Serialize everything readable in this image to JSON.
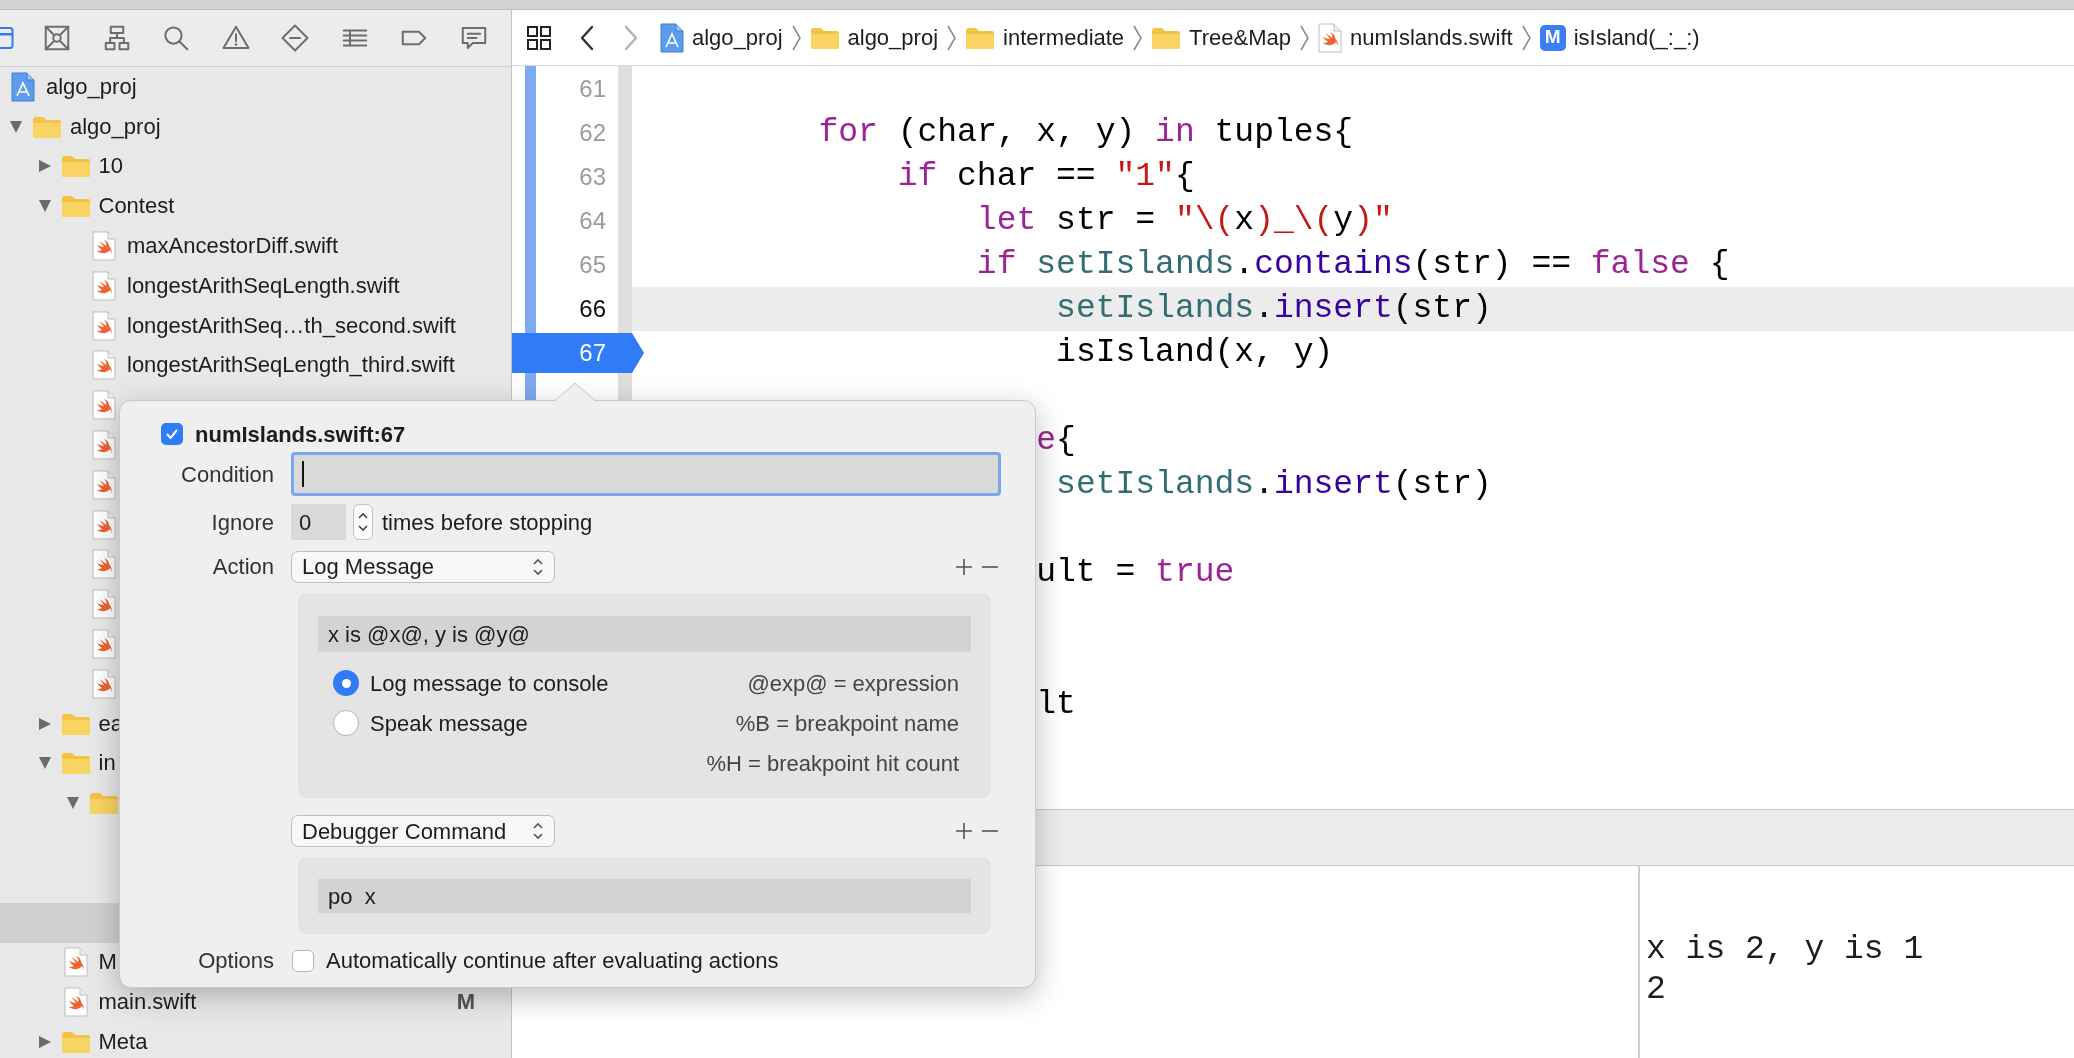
{
  "navigator_tabs": [
    {
      "kind": "project",
      "selected": true
    },
    {
      "kind": "source-control",
      "selected": false
    },
    {
      "kind": "symbols",
      "selected": false
    },
    {
      "kind": "find",
      "selected": false
    },
    {
      "kind": "issues",
      "selected": false
    },
    {
      "kind": "tests",
      "selected": false
    },
    {
      "kind": "debug",
      "selected": false
    },
    {
      "kind": "breakpoints",
      "selected": false
    },
    {
      "kind": "reports",
      "selected": false
    }
  ],
  "project_navigator": [
    {
      "kind": "project",
      "label": "algo_proj",
      "selected": false
    },
    {
      "kind": "folder",
      "label": "algo_proj",
      "expanded": true,
      "selected": false,
      "children": [
        {
          "kind": "folder",
          "label": "10",
          "expanded": false,
          "selected": false
        },
        {
          "kind": "folder",
          "label": "Contest",
          "expanded": true,
          "selected": false,
          "children": [
            {
              "kind": "swift",
              "label": "maxAncestorDiff.swift",
              "selected": false
            },
            {
              "kind": "swift",
              "label": "longestArithSeqLength.swift",
              "selected": false
            },
            {
              "kind": "swift",
              "label": "longestArithSeq…th_second.swift",
              "selected": false
            },
            {
              "kind": "swift",
              "label": "longestArithSeqLength_third.swift",
              "selected": false
            },
            {
              "kind": "swift",
              "selected": false
            },
            {
              "kind": "swift",
              "selected": false
            },
            {
              "kind": "swift",
              "selected": false
            },
            {
              "kind": "swift",
              "selected": false
            },
            {
              "kind": "swift",
              "selected": false
            },
            {
              "kind": "swift",
              "selected": false
            },
            {
              "kind": "swift",
              "selected": false
            },
            {
              "kind": "swift",
              "selected": false
            }
          ]
        },
        {
          "kind": "folder",
          "label": "ea",
          "expanded": false,
          "selected": false
        },
        {
          "kind": "folder",
          "label": "in",
          "expanded": true,
          "selected": false,
          "children": [
            {
              "kind": "folder",
              "expanded": true,
              "selected": false,
              "children": [
                {
                  "selected": false
                },
                {
                  "selected": false
                },
                {
                  "selected": true
                }
              ]
            }
          ]
        },
        {
          "kind": "swift",
          "label": "M",
          "selected": false
        },
        {
          "kind": "swift",
          "label": "main.swift",
          "status": "M",
          "selected": false
        },
        {
          "kind": "folder",
          "label": "Meta",
          "expanded": false,
          "selected": false
        }
      ]
    }
  ],
  "editor": {
    "jump_bar": {
      "back_enabled": true,
      "forward_enabled": false,
      "path": [
        {
          "kind": "project",
          "label": "algo_proj"
        },
        {
          "kind": "folder",
          "label": "algo_proj"
        },
        {
          "kind": "folder",
          "label": "intermediate"
        },
        {
          "kind": "folder",
          "label": "Tree&Map"
        },
        {
          "kind": "swift",
          "label": "numIslands.swift"
        },
        {
          "kind": "method",
          "badge": "M",
          "label": "isIsland(_:_:)"
        }
      ]
    },
    "lines": [
      {
        "number": "61",
        "highlighted": false,
        "breakpoint": false
      },
      {
        "number": "62",
        "highlighted": false,
        "breakpoint": false,
        "tokens": [
          {
            "kind": "keyword",
            "text": "        for"
          },
          {
            "kind": "plain",
            "text": " (char, x, y) "
          },
          {
            "kind": "keyword",
            "text": "in"
          },
          {
            "kind": "plain",
            "text": " tuples{"
          }
        ]
      },
      {
        "number": "63",
        "highlighted": false,
        "breakpoint": false,
        "tokens": [
          {
            "kind": "keyword",
            "text": "            if"
          },
          {
            "kind": "plain",
            "text": " char == "
          },
          {
            "kind": "string",
            "text": "\"1\""
          },
          {
            "kind": "plain",
            "text": "{"
          }
        ]
      },
      {
        "number": "64",
        "highlighted": false,
        "breakpoint": false,
        "tokens": [
          {
            "kind": "keyword",
            "text": "                let"
          },
          {
            "kind": "plain",
            "text": " str = "
          },
          {
            "kind": "string",
            "text": "\"\\("
          },
          {
            "kind": "plain",
            "text": "x"
          },
          {
            "kind": "string",
            "text": ")_\\("
          },
          {
            "kind": "plain",
            "text": "y"
          },
          {
            "kind": "string",
            "text": ")\""
          }
        ]
      },
      {
        "number": "65",
        "highlighted": false,
        "breakpoint": false,
        "tokens": [
          {
            "kind": "keyword",
            "text": "                if"
          },
          {
            "kind": "property",
            "text": " setIslands"
          },
          {
            "kind": "plain",
            "text": "."
          },
          {
            "kind": "method",
            "text": "contains"
          },
          {
            "kind": "plain",
            "text": "(str) == "
          },
          {
            "kind": "keyword",
            "text": "false"
          },
          {
            "kind": "plain",
            "text": " {"
          }
        ]
      },
      {
        "number": "66",
        "highlighted": true,
        "breakpoint": false,
        "tokens": [
          {
            "kind": "property",
            "text": "                    setIslands"
          },
          {
            "kind": "plain",
            "text": "."
          },
          {
            "kind": "method",
            "text": "insert"
          },
          {
            "kind": "plain",
            "text": "(str)"
          }
        ]
      },
      {
        "number": "67",
        "highlighted": false,
        "breakpoint": true,
        "tokens": [
          {
            "kind": "plain",
            "text": "                    isIsland(x, y)"
          }
        ]
      },
      {
        "highlighted": false
      },
      {
        "highlighted": false,
        "tokens": [
          {
            "kind": "keyword",
            "text": "                   e"
          },
          {
            "kind": "plain",
            "text": "{"
          }
        ]
      },
      {
        "highlighted": false,
        "tokens": [
          {
            "kind": "property",
            "text": "                    setIslands"
          },
          {
            "kind": "plain",
            "text": "."
          },
          {
            "kind": "method",
            "text": "insert"
          },
          {
            "kind": "plain",
            "text": "(str)"
          }
        ]
      },
      {
        "highlighted": false
      },
      {
        "highlighted": false,
        "tokens": [
          {
            "kind": "plain",
            "text": "                   ult = "
          },
          {
            "kind": "keyword",
            "text": "true"
          }
        ]
      },
      {
        "highlighted": false
      },
      {
        "highlighted": false
      },
      {
        "highlighted": false,
        "tokens": [
          {
            "kind": "plain",
            "text": "                   lt"
          }
        ]
      }
    ]
  },
  "debug_area": {
    "console_output": [
      "x is 2, y is 1",
      "2"
    ]
  },
  "breakpoint_editor": {
    "enabled": true,
    "title": "numIslands.swift:67",
    "condition": {
      "label": "Condition",
      "focused": true
    },
    "ignore": {
      "label": "Ignore",
      "value": "0",
      "suffix": "times before stopping"
    },
    "action_label": "Action",
    "actions": [
      {
        "kind": "log",
        "type": "Log Message",
        "message": "x is @x@, y is @y@",
        "modes": [
          {
            "label": "Log message to console",
            "selected": true
          },
          {
            "label": "Speak message",
            "selected": false
          }
        ],
        "hints": [
          "@exp@ = expression",
          "%B = breakpoint name",
          "%H = breakpoint hit count"
        ]
      },
      {
        "kind": "command",
        "type": "Debugger Command",
        "command": "po  x"
      }
    ],
    "options": {
      "label": "Options",
      "checked": false,
      "text": "Automatically continue after evaluating actions"
    }
  }
}
